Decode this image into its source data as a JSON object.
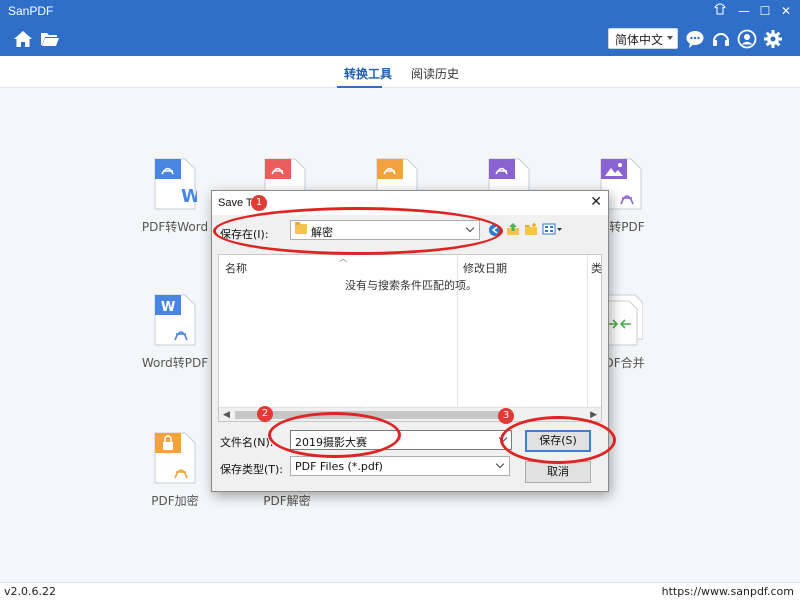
{
  "app": {
    "title": "SanPDF"
  },
  "header": {
    "language": "简体中文"
  },
  "tabs": [
    {
      "label": "转换工具",
      "active": true
    },
    {
      "label": "阅读历史",
      "active": false
    }
  ],
  "tools": [
    {
      "label": "PDF转Word"
    },
    {
      "label": "片转PDF"
    },
    {
      "label": "Word转PDF"
    },
    {
      "label": "PDF合并"
    },
    {
      "label": "PDF加密"
    },
    {
      "label": "PDF解密"
    }
  ],
  "dialog": {
    "title": "Save To",
    "save_in_label": "保存在(I):",
    "save_in_value": "解密",
    "columns": {
      "name": "名称",
      "modified": "修改日期",
      "type": "类"
    },
    "empty_message": "没有与搜索条件匹配的项。",
    "filename_label": "文件名(N):",
    "filename_value": "2019摄影大赛",
    "filetype_label": "保存类型(T):",
    "filetype_value": "PDF Files (*.pdf)",
    "save_button": "保存(S)",
    "cancel_button": "取消"
  },
  "annotations": {
    "badge1": "1",
    "badge2": "2",
    "badge3": "3"
  },
  "status": {
    "version": "v2.0.6.22",
    "website": "https://www.sanpdf.com"
  },
  "colors": {
    "brand_blue": "#2f6fc8",
    "annotation_red": "#e02424"
  }
}
